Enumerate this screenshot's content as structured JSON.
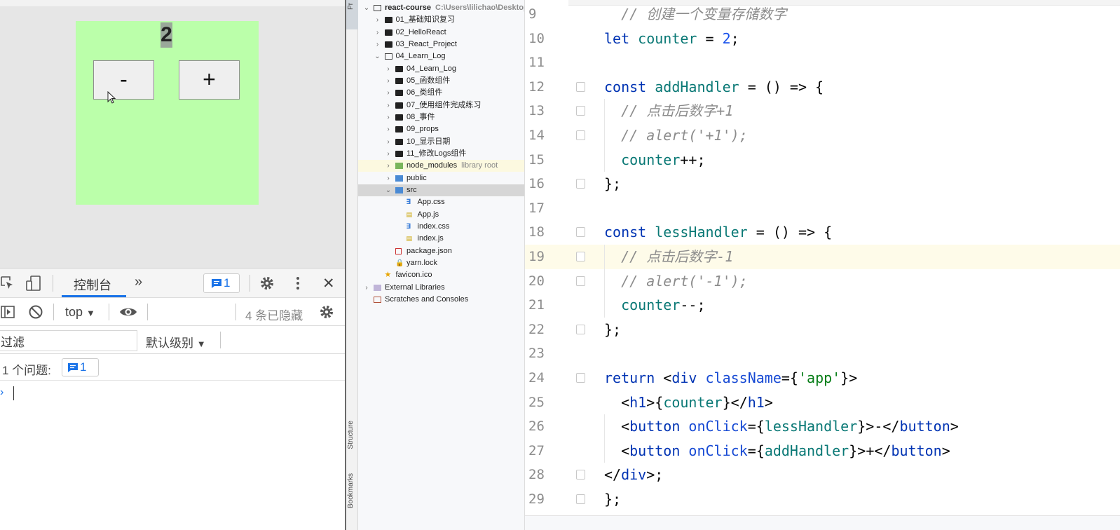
{
  "browser": {
    "app": {
      "counter": "2",
      "minus_label": "-",
      "plus_label": "+",
      "background_color": "#bbffaa"
    },
    "devtools": {
      "toolbar": {
        "console_tab": "控制台",
        "more_tabs": "»",
        "messages_count": "1",
        "close": "✕"
      },
      "console_bar": {
        "context": "top",
        "hidden_count_label": "4 条已隐藏"
      },
      "filter_bar": {
        "filter_value": "过滤",
        "level": "默认级别"
      },
      "issues_bar": {
        "label": "1 个问题:",
        "count": "1"
      },
      "prompt": "›"
    }
  },
  "tool_strip": {
    "project_label": "Pr",
    "structure_label": "Structure",
    "bookmarks_label": "Bookmarks"
  },
  "project_tree": {
    "rows": [
      {
        "arrow": "⌄",
        "label": "react-course",
        "hint": "C:\\Users\\lilichao\\Desktop",
        "icon": "folder-open",
        "level": 0,
        "bold": true
      },
      {
        "arrow": "›",
        "label": "01_基础知识复习",
        "icon": "folder",
        "level": 1
      },
      {
        "arrow": "›",
        "label": "02_HelloReact",
        "icon": "folder",
        "level": 1
      },
      {
        "arrow": "›",
        "label": "03_React_Project",
        "icon": "folder",
        "level": 1
      },
      {
        "arrow": "⌄",
        "label": "04_Learn_Log",
        "icon": "folder-open",
        "level": 1
      },
      {
        "arrow": "›",
        "label": "04_Learn_Log",
        "icon": "folder",
        "level": 2
      },
      {
        "arrow": "›",
        "label": "05_函数组件",
        "icon": "folder",
        "level": 2
      },
      {
        "arrow": "›",
        "label": "06_类组件",
        "icon": "folder",
        "level": 2
      },
      {
        "arrow": "›",
        "label": "07_使用组件完成练习",
        "icon": "folder",
        "level": 2
      },
      {
        "arrow": "›",
        "label": "08_事件",
        "icon": "folder",
        "level": 2
      },
      {
        "arrow": "›",
        "label": "09_props",
        "icon": "folder",
        "level": 2
      },
      {
        "arrow": "›",
        "label": "10_显示日期",
        "icon": "folder",
        "level": 2
      },
      {
        "arrow": "›",
        "label": "11_修改Logs组件",
        "icon": "folder",
        "level": 2
      },
      {
        "arrow": "›",
        "label": "node_modules",
        "hint": "library root",
        "icon": "folder-green",
        "level": 2,
        "style": "highlight-lib"
      },
      {
        "arrow": "›",
        "label": "public",
        "icon": "folder-blue",
        "level": 2
      },
      {
        "arrow": "⌄",
        "label": "src",
        "icon": "folder-blue",
        "level": 2,
        "style": "selected"
      },
      {
        "arrow": "",
        "label": "App.css",
        "icon": "file-css",
        "level": 3
      },
      {
        "arrow": "",
        "label": "App.js",
        "icon": "file-js",
        "level": 3
      },
      {
        "arrow": "",
        "label": "index.css",
        "icon": "file-css",
        "level": 3
      },
      {
        "arrow": "",
        "label": "index.js",
        "icon": "file-js",
        "level": 3
      },
      {
        "arrow": "",
        "label": "package.json",
        "icon": "file-json",
        "level": 2
      },
      {
        "arrow": "",
        "label": "yarn.lock",
        "icon": "file-lock",
        "level": 2
      },
      {
        "arrow": "",
        "label": "favicon.ico",
        "icon": "file-ico",
        "level": 1
      },
      {
        "arrow": "›",
        "label": "External Libraries",
        "icon": "lib-icon",
        "level": 0
      },
      {
        "arrow": "",
        "label": "Scratches and Consoles",
        "icon": "scratch-icon",
        "level": 0
      }
    ]
  },
  "editor": {
    "current_line": 19,
    "lines": [
      {
        "no": "9",
        "fold": false,
        "tokens": [
          [
            "cm",
            "  // 创建一个变量存储数字"
          ]
        ]
      },
      {
        "no": "10",
        "fold": false,
        "tokens": [
          [
            "kw",
            "let "
          ],
          [
            "vr",
            "counter"
          ],
          [
            "",
            " = "
          ],
          [
            "nm",
            "2"
          ],
          [
            "",
            ";"
          ]
        ]
      },
      {
        "no": "11",
        "fold": false,
        "tokens": []
      },
      {
        "no": "12",
        "fold": true,
        "tokens": [
          [
            "kw",
            "const "
          ],
          [
            "vr",
            "addHandler"
          ],
          [
            "",
            " = () => {"
          ]
        ]
      },
      {
        "no": "13",
        "fold": true,
        "tokens": [
          [
            "cm",
            "  // 点击后数字+1"
          ]
        ]
      },
      {
        "no": "14",
        "fold": true,
        "tokens": [
          [
            "cm",
            "  // alert('+1');"
          ]
        ]
      },
      {
        "no": "15",
        "fold": false,
        "tokens": [
          [
            "",
            "  "
          ],
          [
            "vr",
            "counter"
          ],
          [
            "",
            "++;"
          ]
        ]
      },
      {
        "no": "16",
        "fold": true,
        "tokens": [
          [
            "",
            "};"
          ]
        ]
      },
      {
        "no": "17",
        "fold": false,
        "tokens": []
      },
      {
        "no": "18",
        "fold": true,
        "tokens": [
          [
            "kw",
            "const "
          ],
          [
            "vr",
            "lessHandler"
          ],
          [
            "",
            " = () => {"
          ]
        ]
      },
      {
        "no": "19",
        "fold": true,
        "tokens": [
          [
            "cm",
            "  // 点击后数字-1"
          ]
        ]
      },
      {
        "no": "20",
        "fold": true,
        "tokens": [
          [
            "cm",
            "  // alert('-1');"
          ]
        ]
      },
      {
        "no": "21",
        "fold": false,
        "tokens": [
          [
            "",
            "  "
          ],
          [
            "vr",
            "counter"
          ],
          [
            "",
            "--;"
          ]
        ]
      },
      {
        "no": "22",
        "fold": true,
        "tokens": [
          [
            "",
            "};"
          ]
        ]
      },
      {
        "no": "23",
        "fold": false,
        "tokens": []
      },
      {
        "no": "24",
        "fold": true,
        "tokens": [
          [
            "kw",
            "return "
          ],
          [
            "",
            "<"
          ],
          [
            "tg",
            "div "
          ],
          [
            "at",
            "className"
          ],
          [
            "",
            "={"
          ],
          [
            "st",
            "'app'"
          ],
          [
            "",
            "}>"
          ]
        ]
      },
      {
        "no": "25",
        "fold": false,
        "tokens": [
          [
            "",
            "  <"
          ],
          [
            "tg",
            "h1"
          ],
          [
            "",
            ">{"
          ],
          [
            "vr",
            "counter"
          ],
          [
            "",
            "}</"
          ],
          [
            "tg",
            "h1"
          ],
          [
            "",
            ">"
          ]
        ]
      },
      {
        "no": "26",
        "fold": false,
        "tokens": [
          [
            "",
            "  <"
          ],
          [
            "tg",
            "button "
          ],
          [
            "at",
            "onClick"
          ],
          [
            "",
            "={"
          ],
          [
            "vr",
            "lessHandler"
          ],
          [
            "",
            "}>-</"
          ],
          [
            "tg",
            "button"
          ],
          [
            "",
            ">"
          ]
        ]
      },
      {
        "no": "27",
        "fold": false,
        "tokens": [
          [
            "",
            "  <"
          ],
          [
            "tg",
            "button "
          ],
          [
            "at",
            "onClick"
          ],
          [
            "",
            "={"
          ],
          [
            "vr",
            "addHandler"
          ],
          [
            "",
            "}>+</"
          ],
          [
            "tg",
            "button"
          ],
          [
            "",
            ">"
          ]
        ]
      },
      {
        "no": "28",
        "fold": true,
        "tokens": [
          [
            "",
            "</"
          ],
          [
            "tg",
            "div"
          ],
          [
            "",
            ">;"
          ]
        ]
      },
      {
        "no": "29",
        "fold": true,
        "tokens": [
          [
            "",
            "};"
          ]
        ]
      }
    ]
  }
}
